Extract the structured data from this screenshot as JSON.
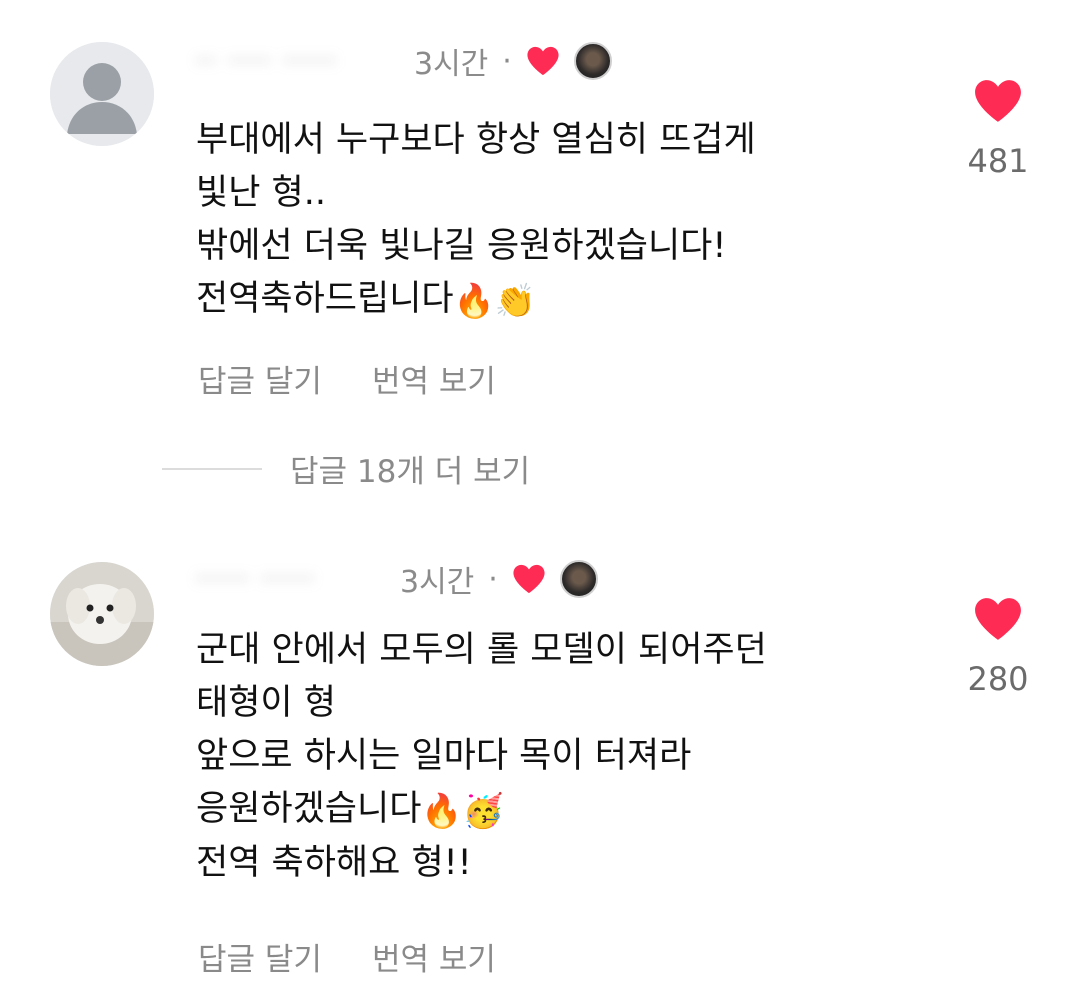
{
  "comments": [
    {
      "username": "·· ···· ·····",
      "time": "3시간",
      "separator": "·",
      "lines": [
        "부대에서 누구보다 항상 열심히 뜨겁게",
        "빛난 형..",
        "밖에선 더욱 빛나길 응원하겠습니다!",
        "전역축하드립니다"
      ],
      "emojis": [
        "🔥",
        "👏"
      ],
      "reply_label": "답글 달기",
      "translate_label": "번역 보기",
      "likes": "481"
    },
    {
      "username": "·····  ·····",
      "time": "3시간",
      "separator": "·",
      "lines": [
        "군대 안에서 모두의 롤 모델이 되어주던",
        "태형이 형",
        "앞으로 하시는 일마다 목이 터져라",
        "응원하겠습니다",
        "전역 축하해요 형!!"
      ],
      "emojis": [
        "🔥",
        "🥳"
      ],
      "reply_label": "답글 달기",
      "translate_label": "번역 보기",
      "likes": "280"
    }
  ],
  "more_replies_label": "답글 18개 더 보기",
  "colors": {
    "heart": "#fe2c55",
    "muted_text": "#8a8a8a",
    "body_text": "#111111"
  },
  "icons": {
    "like": "heart-icon",
    "default_avatar": "person-icon"
  }
}
